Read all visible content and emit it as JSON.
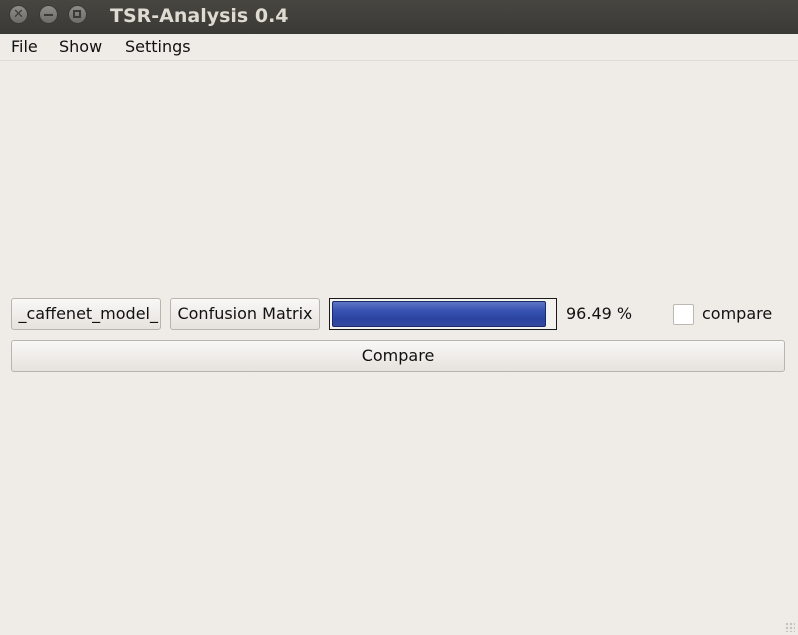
{
  "window": {
    "title": "TSR-Analysis 0.4",
    "controls": {
      "close_icon": "close-icon",
      "minimize_icon": "minimize-icon",
      "maximize_icon": "maximize-icon"
    }
  },
  "menubar": {
    "items": [
      {
        "label": "File"
      },
      {
        "label": "Show"
      },
      {
        "label": "Settings"
      }
    ]
  },
  "controls": {
    "model_button_label": "_caffenet_model_",
    "confusion_button_label": "Confusion Matrix",
    "progress_percent": 96.49,
    "progress_label": "96.49 %",
    "progress_color": "#3853b2",
    "compare_checkbox_checked": false,
    "compare_checkbox_label": "compare",
    "compare_button_label": "Compare"
  }
}
